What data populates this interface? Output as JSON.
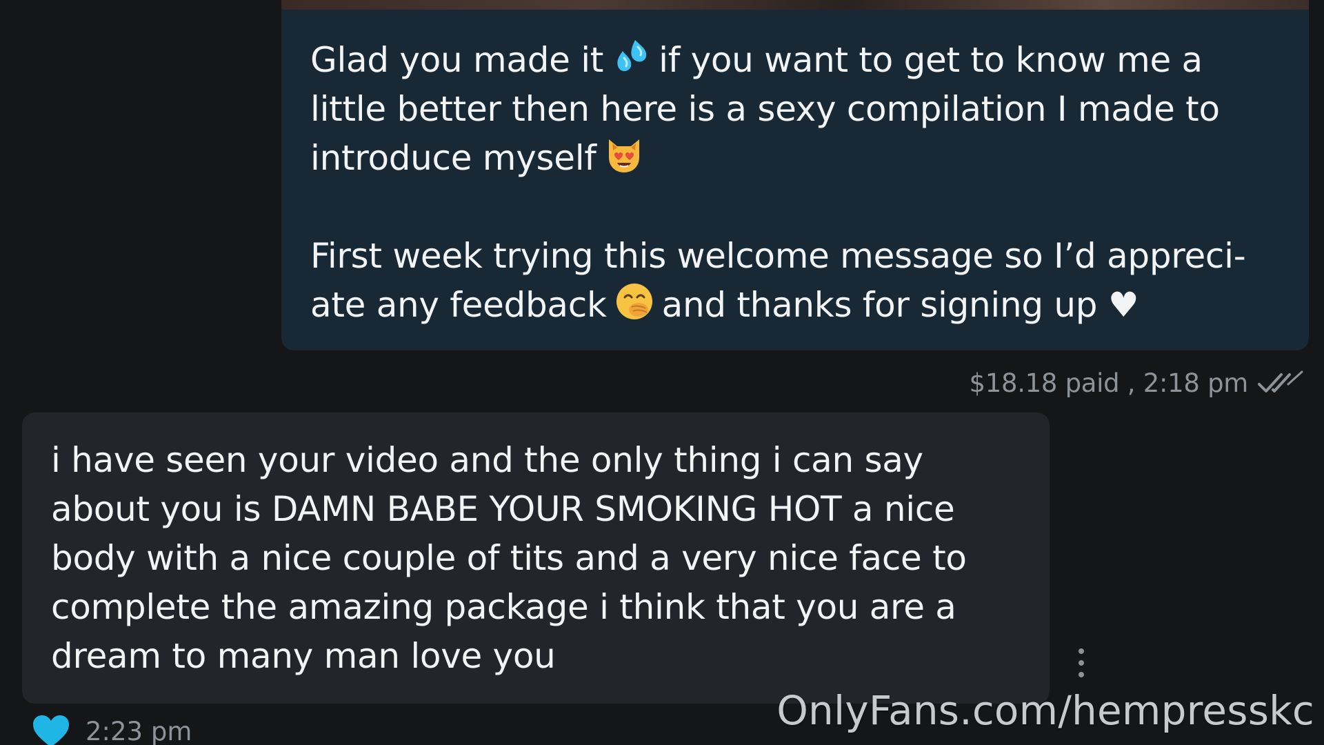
{
  "outgoing_message": {
    "line_1_before_emoji": "Glad you made it",
    "line_1_after_emoji": "if you want to get to know me a little better then here is a sexy compilation I made to introduce myself",
    "paragraph_2_before_emoji": "First week trying this welcome message so I’d appreci-ate any feedback",
    "paragraph_2_after_emoji": "and thanks for signing up ♥",
    "emojis": [
      "sweat-droplets-icon",
      "heart-eyes-cat-icon",
      "face-with-hand-over-mouth-icon"
    ],
    "meta": "$18.18 paid , 2:18 pm",
    "status_icon": "double-check-icon"
  },
  "incoming_message": {
    "text": "i have seen your video and the only thing i can say about you is DAMN BABE YOUR SMOKING HOT a nice body with a nice couple of tits and a very nice face to complete the amazing package i think that you are a dream to many man love you",
    "time": "2:23 pm",
    "liked_icon": "heart-icon",
    "like_color": "#1fb6e6"
  },
  "watermark": "OnlyFans.com/hempresskc",
  "colors": {
    "background": "#141618",
    "outgoing_bubble": "#182834",
    "incoming_bubble": "#222529",
    "meta_text": "#8d9398"
  }
}
